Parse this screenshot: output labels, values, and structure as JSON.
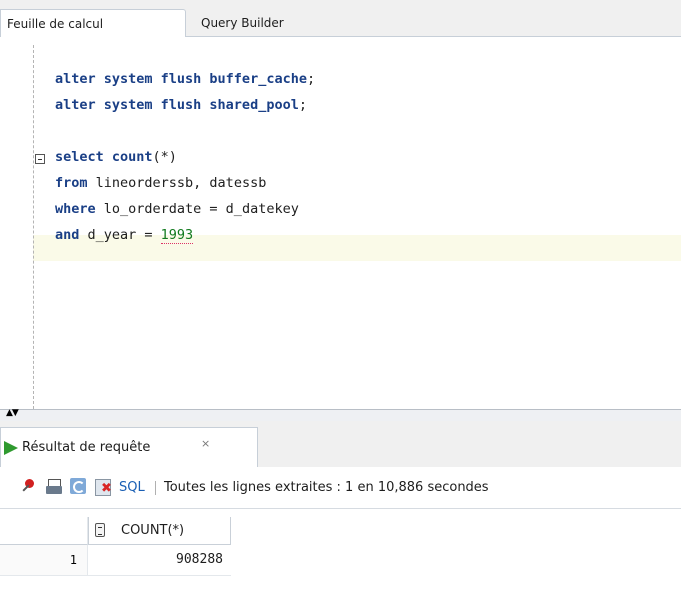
{
  "editor_tabs": [
    {
      "label": "Feuille de calcul",
      "active": true
    },
    {
      "label": "Query Builder",
      "active": false
    }
  ],
  "code_lines": [
    {
      "type": "kw",
      "kw": "alter system flush buffer_cache",
      "rest": ";"
    },
    {
      "type": "kw",
      "kw": "alter system flush shared_pool",
      "rest": ";"
    },
    {
      "type": "blank"
    },
    {
      "type": "select",
      "kw": "select count",
      "rest": "(*)"
    },
    {
      "type": "kw_rest",
      "kw": "from",
      "rest": " lineorderssb, datessb"
    },
    {
      "type": "kw_rest",
      "kw": "where",
      "rest": " lo_orderdate = d_datekey"
    },
    {
      "type": "kw_num",
      "kw": "and",
      "rest": " d_year = ",
      "num": "1993"
    }
  ],
  "result_tab": {
    "label": "Résultat de requête",
    "close": "×"
  },
  "toolbar": {
    "sql_label": "SQL",
    "status": "Toutes les lignes extraites : 1 en 10,886 secondes"
  },
  "grid": {
    "columns": [
      "COUNT(*)"
    ],
    "rows": [
      {
        "num": "1",
        "values": [
          "908288"
        ]
      }
    ]
  },
  "colors": {
    "keyword": "#1a3f86",
    "number": "#117a1e",
    "current_line": "#fafae8",
    "run_icon": "#2f9a2f"
  }
}
